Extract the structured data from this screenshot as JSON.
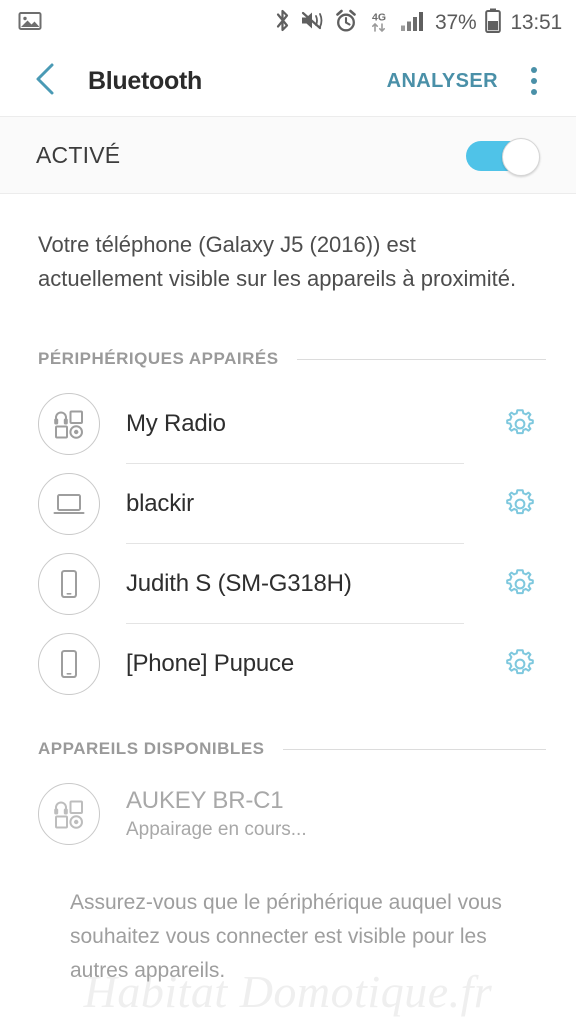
{
  "status_bar": {
    "left_icons": [
      "image-icon"
    ],
    "right_icons": [
      "bluetooth-icon",
      "sound-mute-vibrate-icon",
      "alarm-icon",
      "4g-data-icon",
      "signal-bars-icon",
      "battery-icon"
    ],
    "network_label": "4G",
    "battery_percent": "37%",
    "clock": "13:51"
  },
  "app_bar": {
    "back_icon": "chevron-left-icon",
    "title": "Bluetooth",
    "action_label": "ANALYSER",
    "overflow_icon": "more-vertical-icon"
  },
  "master_switch": {
    "label": "ACTIVÉ",
    "state": "on",
    "track_color": "#4fc3e8"
  },
  "description": "Votre téléphone (Galaxy J5 (2016)) est actuellement visible sur les appareils à proximité.",
  "paired_section": {
    "label": "PÉRIPHÉRIQUES APPAIRÉS",
    "devices": [
      {
        "name": "My Radio",
        "icon": "multi-device-icon",
        "settings_icon": "gear-icon",
        "divider": true
      },
      {
        "name": "blackir",
        "icon": "laptop-icon",
        "settings_icon": "gear-icon",
        "divider": true
      },
      {
        "name": "Judith S (SM-G318H)",
        "icon": "phone-icon",
        "settings_icon": "gear-icon",
        "divider": true
      },
      {
        "name": "[Phone] Pupuce",
        "icon": "phone-icon",
        "settings_icon": "gear-icon",
        "divider": false
      }
    ]
  },
  "available_section": {
    "label": "APPAREILS DISPONIBLES",
    "devices": [
      {
        "name": "AUKEY BR-C1",
        "subtitle": "Appairage en cours...",
        "icon": "multi-device-icon",
        "dim": true
      }
    ]
  },
  "footer_note": "Assurez-vous que le périphérique auquel vous souhaitez vous connecter est visible pour les autres appareils.",
  "watermark": "Habitat Domotique.fr",
  "colors": {
    "accent": "#4a90a8",
    "toggle_on": "#4fc3e8",
    "gear": "#7ec8de",
    "section_label": "#9a9a9a"
  }
}
